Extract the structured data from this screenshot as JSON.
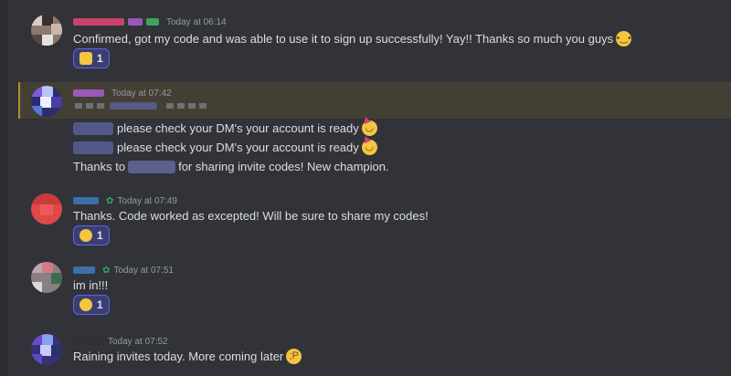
{
  "messages": [
    {
      "timestamp": "Today at 06:14",
      "lines": [
        "Confirmed, got my code and was able to use it to sign up successfully! Yay!! Thanks so much you guys"
      ],
      "reaction_count": "1",
      "emoji": "pleading-face"
    },
    {
      "timestamp": "Today at 07:42",
      "line1": "please check your DM's your account is ready",
      "line2": "please check your DM's your account is ready",
      "line3_a": "Thanks to",
      "line3_b": "for sharing invite codes! New champion."
    },
    {
      "timestamp": "Today at 07:49",
      "lines": [
        "Thanks. Code worked as excepted! Will be sure to share my codes!"
      ],
      "reaction_count": "1"
    },
    {
      "timestamp": "Today at 07:51",
      "lines": [
        "im in!!!"
      ],
      "reaction_count": "1"
    },
    {
      "timestamp": "Today at 07:52",
      "lines": [
        "Raining invites today. More coming later"
      ]
    }
  ],
  "colors": {
    "background": "#313338",
    "highlight": "#433f34",
    "reaction_border": "#5865f2"
  }
}
